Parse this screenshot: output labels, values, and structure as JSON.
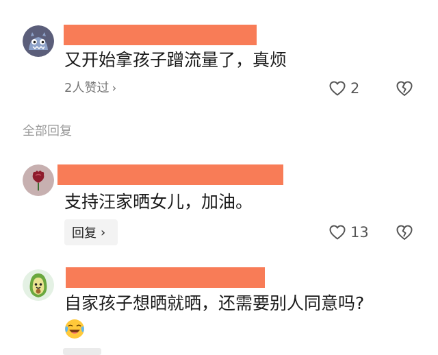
{
  "comments": [
    {
      "text": "又开始拿孩子蹭流量了，真烦",
      "likers_text": "2人赞过",
      "likers_chevron": "›",
      "like_count": "2",
      "avatar_icon": "gray-monster-avatar-icon"
    },
    {
      "text": "支持汪家晒女儿，加油。",
      "reply_label": "回复",
      "reply_chevron": "›",
      "like_count": "13",
      "avatar_icon": "red-flower-avatar-icon"
    },
    {
      "text": "自家孩子想晒就晒，还需要别人同意吗?",
      "emoji_icon": "laughing-crying-emoji-icon",
      "avatar_icon": "avocado-avatar-icon"
    }
  ],
  "all_replies_label": "全部回复",
  "colors": {
    "name_redaction": "#f87c57",
    "secondary_text": "#777777",
    "icon_stroke": "#555555"
  }
}
